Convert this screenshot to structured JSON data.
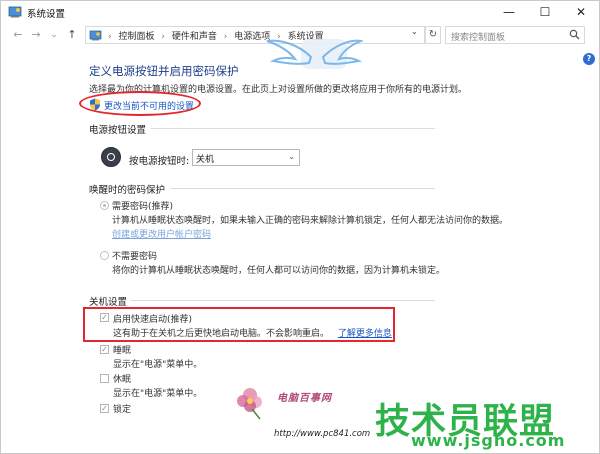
{
  "window": {
    "title": "系统设置",
    "controls": {
      "minimize": "—",
      "maximize": "☐",
      "close": "✕"
    }
  },
  "addressbar": {
    "back": "←",
    "forward": "→",
    "dropdown": "⌄",
    "up": "↑",
    "crumbs": [
      "控制面板",
      "硬件和声音",
      "电源选项",
      "系统设置"
    ],
    "separator": "›",
    "crumb_dropdown": "⌄",
    "refresh": "↻",
    "search_placeholder": "搜索控制面板"
  },
  "help": "?",
  "page": {
    "heading": "定义电源按钮并启用密码保护",
    "subtitle": "选择最为你的计算机设置的电源设置。在此页上对设置所做的更改将应用于你所有的电源计划。",
    "change_link": "更改当前不可用的设置"
  },
  "power_button": {
    "section": "电源按钮设置",
    "label": "按电源按钮时:",
    "selected": "关机",
    "arrow": "⌄"
  },
  "wake_password": {
    "section": "唤醒时的密码保护",
    "option1": {
      "label": "需要密码(推荐)",
      "desc": "计算机从睡眠状态唤醒时，如果未输入正确的密码来解除计算机锁定，任何人都无法访问你的数据。",
      "link": "创建或更改用户帐户密码"
    },
    "option2": {
      "label": "不需要密码",
      "desc": "将你的计算机从睡眠状态唤醒时，任何人都可以访问你的数据，因为计算机未锁定。"
    }
  },
  "shutdown": {
    "section": "关机设置",
    "fast_startup": {
      "label": "启用快速启动(推荐)",
      "desc": "这有助于在关机之后更快地启动电脑。不会影响重启。",
      "link": "了解更多信息",
      "checked": true
    },
    "sleep": {
      "label": "睡眠",
      "desc": "显示在\"电源\"菜单中。",
      "checked": true
    },
    "hibernate": {
      "label": "休眠",
      "desc": "显示在\"电源\"菜单中。",
      "checked": false
    },
    "lock": {
      "label": "锁定",
      "checked": true
    }
  },
  "watermarks": {
    "site_name": "电脑百事网",
    "site_url": "http://www.pc841.com",
    "brand": "技术员联盟",
    "brand_url": "www.jsgho.com"
  },
  "colors": {
    "heading": "#1e3f8a",
    "link": "#1a56c4",
    "highlight": "#e0282e",
    "watermark_green": "#2db34a"
  }
}
